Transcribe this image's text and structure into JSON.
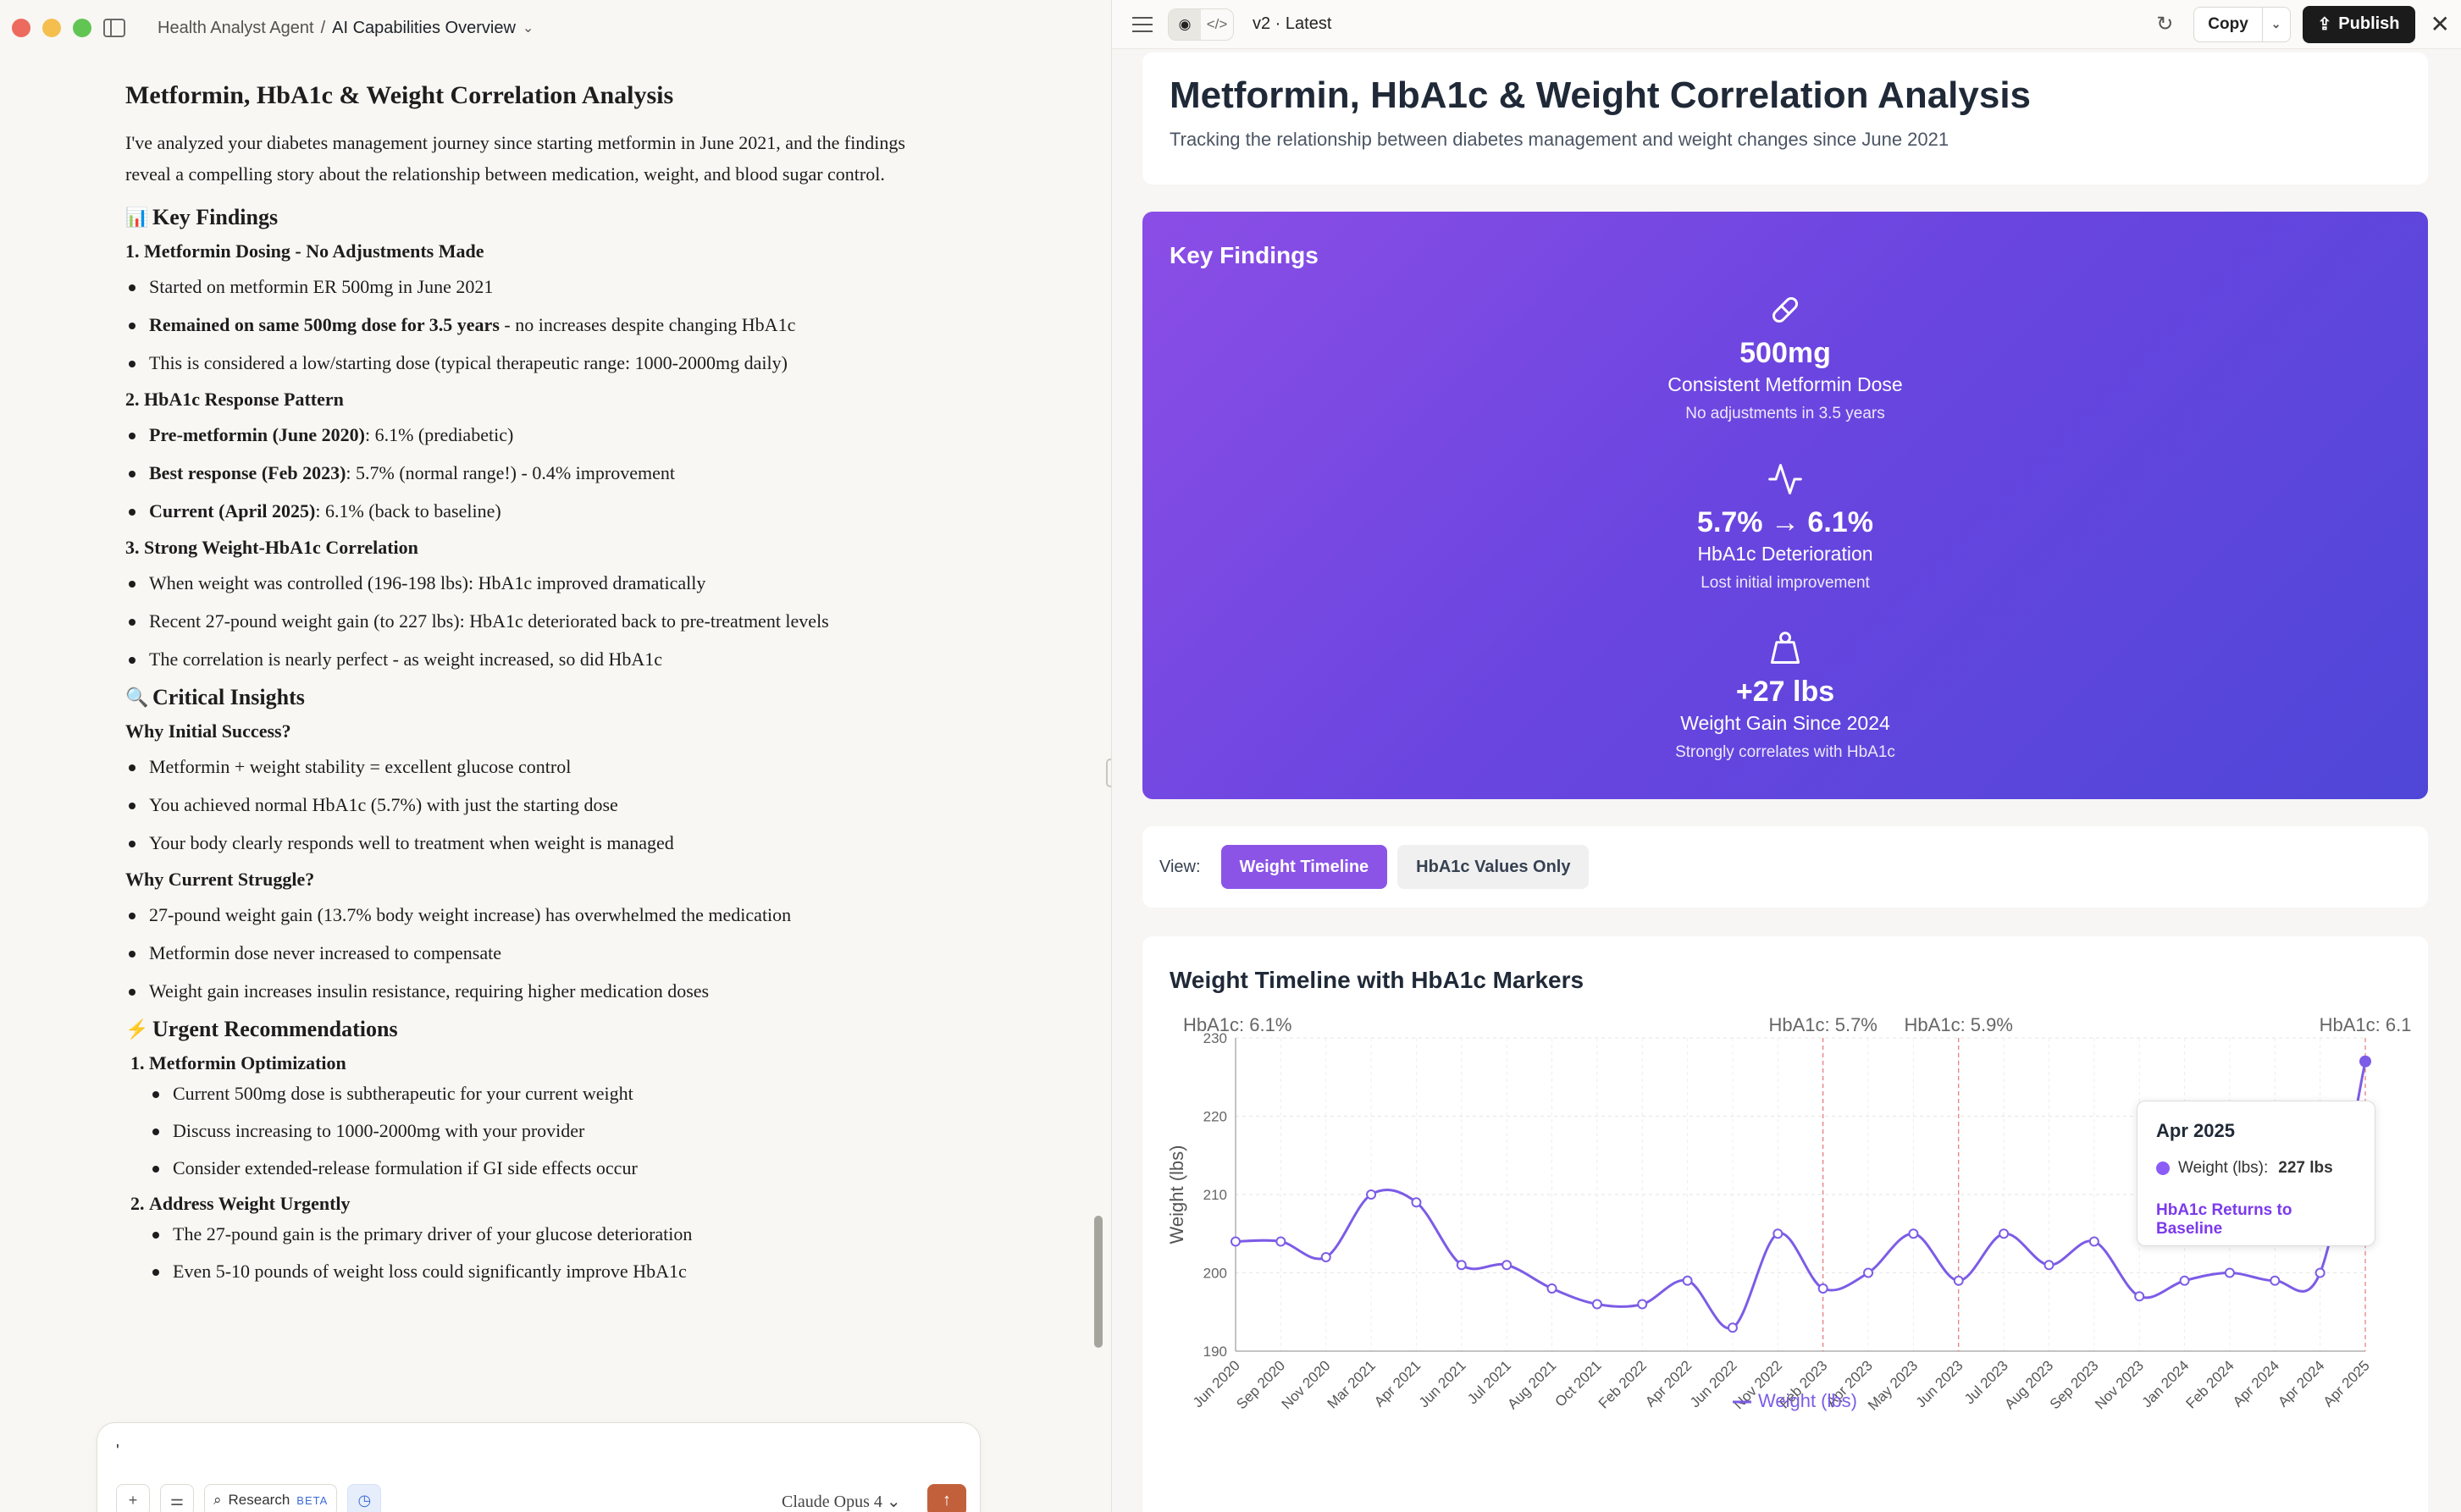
{
  "titlebar": {
    "project": "Health Analyst Agent",
    "separator": "/",
    "chat_title": "AI Capabilities Overview",
    "traffic_colors": [
      "#ed6a5e",
      "#f5bf4f",
      "#61c554"
    ]
  },
  "doc": {
    "title": "Metformin, HbA1c & Weight Correlation Analysis",
    "intro": "I've analyzed your diabetes management journey since starting metformin in June 2021, and the findings reveal a compelling story about the relationship between medication, weight, and blood sugar control.",
    "key_findings_heading": "Key Findings",
    "key_findings_emoji": "📊",
    "s1_heading": "1. Metformin Dosing - No Adjustments Made",
    "s1_b1": "Started on metformin ER 500mg in June 2021",
    "s1_b2_bold": "Remained on same 500mg dose for 3.5 years",
    "s1_b2_rest": " - no increases despite changing HbA1c",
    "s1_b3": "This is considered a low/starting dose (typical therapeutic range: 1000-2000mg daily)",
    "s2_heading": "2. HbA1c Response Pattern",
    "s2_b1_bold": "Pre-metformin (June 2020)",
    "s2_b1_rest": ": 6.1% (prediabetic)",
    "s2_b2_bold": "Best response (Feb 2023)",
    "s2_b2_rest": ": 5.7% (normal range!) - 0.4% improvement",
    "s2_b3_bold": "Current (April 2025)",
    "s2_b3_rest": ": 6.1% (back to baseline)",
    "s3_heading": "3. Strong Weight-HbA1c Correlation",
    "s3_b1": "When weight was controlled (196-198 lbs): HbA1c improved dramatically",
    "s3_b2": "Recent 27-pound weight gain (to 227 lbs): HbA1c deteriorated back to pre-treatment levels",
    "s3_b3": "The correlation is nearly perfect - as weight increased, so did HbA1c",
    "insights_heading": "Critical Insights",
    "insights_emoji": "🔍",
    "why_success": "Why Initial Success?",
    "ws_b1": "Metformin + weight stability = excellent glucose control",
    "ws_b2": "You achieved normal HbA1c (5.7%) with just the starting dose",
    "ws_b3": "Your body clearly responds well to treatment when weight is managed",
    "why_struggle": "Why Current Struggle?",
    "wc_b1": "27-pound weight gain (13.7% body weight increase) has overwhelmed the medication",
    "wc_b2": "Metformin dose never increased to compensate",
    "wc_b3": "Weight gain increases insulin resistance, requiring higher medication doses",
    "rec_heading": "Urgent Recommendations",
    "rec_emoji": "⚡",
    "rec1_title": "Metformin Optimization",
    "rec1_b1": "Current 500mg dose is subtherapeutic for your current weight",
    "rec1_b2": "Discuss increasing to 1000-2000mg with your provider",
    "rec1_b3": "Consider extended-release formulation if GI side effects occur",
    "rec2_title": "Address Weight Urgently",
    "rec2_b1": "The 27-pound gain is the primary driver of your glucose deterioration",
    "rec2_b2": "Even 5-10 pounds of weight loss could significantly improve HbA1c"
  },
  "composer": {
    "input_text": "'",
    "add_icon": "plus-icon",
    "tools_icon": "sliders-icon",
    "research_label": "Research",
    "beta_label": "BETA",
    "model_label": "Claude Opus 4",
    "send_icon": "arrow-up-icon"
  },
  "artifact_toolbar": {
    "version": "v2 · Latest",
    "copy_label": "Copy",
    "publish_label": "Publish"
  },
  "artifact": {
    "title": "Metformin, HbA1c & Weight Correlation Analysis",
    "subtitle": "Tracking the relationship between diabetes management and weight changes since June 2021",
    "key_findings": {
      "heading": "Key Findings",
      "items": [
        {
          "icon": "pill-icon",
          "value": "500mg",
          "label": "Consistent Metformin Dose",
          "sub": "No adjustments in 3.5 years"
        },
        {
          "icon": "activity-icon",
          "value": "5.7% → 6.1%",
          "label": "HbA1c Deterioration",
          "sub": "Lost initial improvement"
        },
        {
          "icon": "weight-icon",
          "value": "+27 lbs",
          "label": "Weight Gain Since 2024",
          "sub": "Strongly correlates with HbA1c"
        }
      ]
    },
    "view": {
      "label": "View:",
      "active": "Weight Timeline",
      "inactive": "HbA1c Values Only"
    },
    "chart_title": "Weight Timeline with HbA1c Markers",
    "tooltip": {
      "title": "Apr 2025",
      "series": "Weight (lbs):",
      "value": "227 lbs",
      "note": "HbA1c Returns to Baseline"
    }
  },
  "chart_data": {
    "type": "line",
    "title": "Weight Timeline with HbA1c Markers",
    "ylabel": "Weight (lbs)",
    "xlabel": "",
    "ylim": [
      190,
      230
    ],
    "yticks": [
      190,
      200,
      210,
      220,
      230
    ],
    "legend": "bottom",
    "grid": true,
    "color": "#7c5ce6",
    "x": [
      "Jun 2020",
      "Sep 2020",
      "Nov 2020",
      "Mar 2021",
      "Apr 2021",
      "Jun 2021",
      "Jul 2021",
      "Aug 2021",
      "Oct 2021",
      "Feb 2022",
      "Apr 2022",
      "Jun 2022",
      "Nov 2022",
      "Feb 2023",
      "Apr 2023",
      "May 2023",
      "Jun 2023",
      "Jul 2023",
      "Aug 2023",
      "Sep 2023",
      "Nov 2023",
      "Jan 2024",
      "Feb 2024",
      "Apr 2024",
      "Apr 2024",
      "Apr 2025"
    ],
    "series": [
      {
        "name": "Weight (lbs)",
        "values": [
          204,
          204,
          202,
          210,
          209,
          201,
          201,
          198,
          196,
          196,
          199,
          193,
          205,
          198,
          200,
          205,
          199,
          205,
          201,
          204,
          197,
          199,
          200,
          199,
          200,
          227
        ]
      }
    ],
    "markers": [
      {
        "index": 0,
        "label": "HbA1c: 6.1%"
      },
      {
        "index": 13,
        "label": "HbA1c: 5.7%"
      },
      {
        "index": 16,
        "label": "HbA1c: 5.9%"
      },
      {
        "index": 25,
        "label": "HbA1c: 6.1"
      }
    ]
  }
}
